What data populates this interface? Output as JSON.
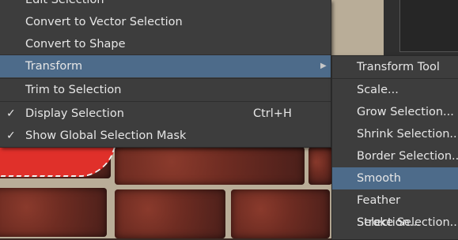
{
  "context_menu": {
    "items": [
      {
        "label": "Edit Selection",
        "shortcut": "",
        "checked": false,
        "has_submenu": false,
        "active": false
      },
      {
        "label": "Convert to Vector Selection",
        "shortcut": "",
        "checked": false,
        "has_submenu": false,
        "active": false
      },
      {
        "label": "Convert to Shape",
        "shortcut": "",
        "checked": false,
        "has_submenu": false,
        "active": false
      },
      {
        "label": "Transform",
        "shortcut": "",
        "checked": false,
        "has_submenu": true,
        "active": true
      },
      {
        "label": "Trim to Selection",
        "shortcut": "",
        "checked": false,
        "has_submenu": false,
        "active": false
      },
      {
        "label": "Display Selection",
        "shortcut": "Ctrl+H",
        "checked": true,
        "has_submenu": false,
        "active": false
      },
      {
        "label": "Show Global Selection Mask",
        "shortcut": "",
        "checked": true,
        "has_submenu": false,
        "active": false
      }
    ],
    "check_glyph": "✓",
    "submenu_arrow": "▶"
  },
  "transform_submenu": {
    "items": [
      {
        "label": "Transform Tool",
        "active": false
      },
      {
        "label": "Scale...",
        "active": false
      },
      {
        "label": "Grow Selection...",
        "active": false
      },
      {
        "label": "Shrink Selection...",
        "active": false
      },
      {
        "label": "Border Selection...",
        "active": false
      },
      {
        "label": "Smooth",
        "active": true
      },
      {
        "label": "Feather Selection...",
        "active": false
      },
      {
        "label": "Stroke Selection...",
        "active": false
      }
    ]
  },
  "colors": {
    "menu_bg": "#3d3d3d",
    "highlight": "#4d6b8a",
    "text": "#e6e6e6"
  }
}
